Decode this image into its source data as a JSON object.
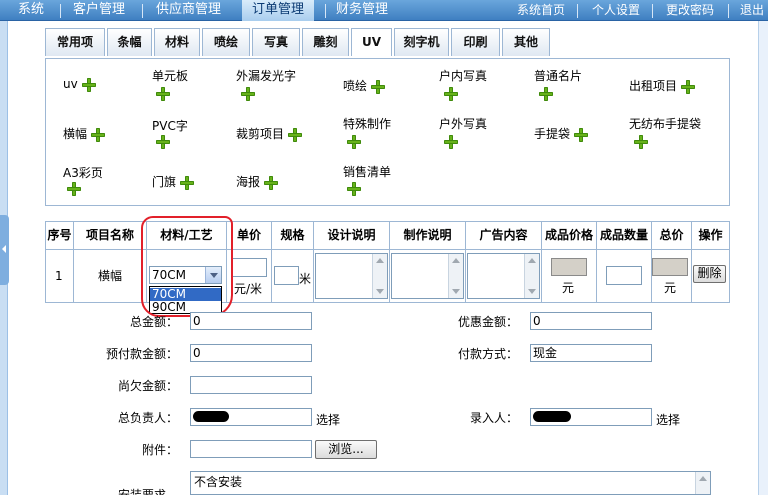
{
  "topnav": {
    "left": [
      "系统",
      "客户管理",
      "供应商管理",
      "订单管理",
      "财务管理"
    ],
    "active_index": 3,
    "right": [
      "系统首页",
      "个人设置",
      "更改密码",
      "退出"
    ]
  },
  "category_tabs": [
    "常用项",
    "条幅",
    "材料",
    "喷绘",
    "写真",
    "雕刻",
    "UV",
    "刻字机",
    "印刷",
    "其他"
  ],
  "uv_items": [
    "uv",
    "单元板",
    "外漏发光字",
    "喷绘",
    "户内写真",
    "普通名片",
    "出租项目",
    "横幅",
    "PVC字",
    "裁剪项目",
    "特殊制作",
    "户外写真",
    "手提袋",
    "无纺布手提袋",
    "A3彩页",
    "门旗",
    "海报",
    "销售清单"
  ],
  "order_table": {
    "headers": [
      "序号",
      "项目名称",
      "材料/工艺",
      "单价",
      "规格",
      "设计说明",
      "制作说明",
      "广告内容",
      "成品价格",
      "成品数量",
      "总价",
      "操作"
    ],
    "row": {
      "index": "1",
      "name": "横幅",
      "material_selected": "70CM",
      "material_options": [
        "70CM",
        "90CM"
      ],
      "unit_price_unit": "元/米",
      "spec_unit": "米",
      "finished_price_unit": "元",
      "total_unit": "元",
      "delete_label": "删除"
    }
  },
  "form": {
    "total_label": "总金额：",
    "total_value": "0",
    "discount_label": "优惠金额：",
    "discount_value": "0",
    "prepaid_label": "预付款金额：",
    "prepaid_value": "0",
    "payment_label": "付款方式：",
    "payment_value": "现金",
    "owed_label": "尚欠金额：",
    "owed_value": "",
    "manager_label": "总负责人：",
    "select_label": "选择",
    "entry_label": "录入人：",
    "attach_label": "附件：",
    "browse_label": "浏览...",
    "install_label": "安装要求",
    "install_value": "不含安装"
  },
  "colors": {
    "nav_bg": "#3f7fc1",
    "plus_icon": "#67b21a",
    "annotation_circle": "#e2202a",
    "selected_option": "#316ac5"
  }
}
